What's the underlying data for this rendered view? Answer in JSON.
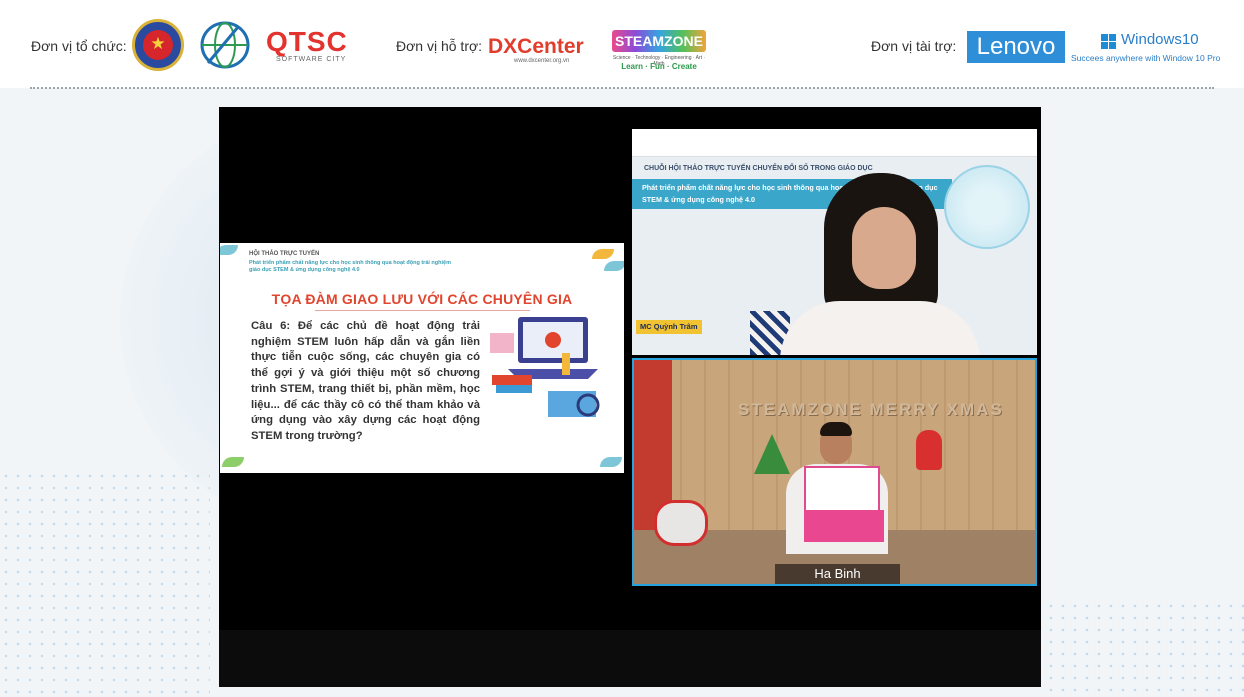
{
  "header": {
    "organizer_label": "Đơn vị tổ chức:",
    "support_label": "Đơn vị hỗ trợ:",
    "sponsor_label": "Đơn vị tài trợ:",
    "qtsc_logo": "QTSC",
    "qtsc_sub": "SOFTWARE CITY",
    "dxcenter_logo": "DXCenter",
    "dxcenter_url": "www.dxcenter.org.vn",
    "steamzone_logo": "STEAMZONE",
    "steamzone_mini": "Science · Technology · Engineering · Art · Math",
    "steamzone_tagline": "Learn · Fun · Create",
    "lenovo_logo": "Lenovo",
    "windows_logo": "Windows10",
    "windows_tagline": "Succees anywhere with Window 10 Pro"
  },
  "slide": {
    "top_label": "HỘI THẢO TRỰC TUYẾN",
    "subtitle": "Phát triển phẩm chất năng lực cho học sinh thông qua hoạt động trải nghiệm giáo dục STEM & ứng dụng công nghệ 4.0",
    "title": "TỌA ĐÀM GIAO LƯU VỚI CÁC CHUYÊN GIA",
    "question": "Câu 6: Để các chủ đề hoạt động trải nghiệm STEM luôn hấp dẫn và gắn liền thực tiễn cuộc sống, các chuyên gia có thể gợi ý và giới thiệu một số chương trình STEM, trang thiết bị, phần mềm, học liệu... để các thầy cô có thể tham khảo và ứng dụng vào xây dựng các hoạt động STEM trong trường?"
  },
  "mc_tile": {
    "series_title": "CHUỖI HỘI THẢO TRỰC TUYẾN CHUYỂN ĐỔI SỐ TRONG GIÁO DỤC",
    "banner": "Phát triển phẩm chất năng lực cho học sinh thông qua hoạt động trải nghiệm giáo dục STEM & ứng dụng công nghệ 4.0",
    "name_tag": "MC Quỳnh Trâm"
  },
  "speaker_tile": {
    "wall_sign": "STEAMZONE MERRY XMAS",
    "name": "Ha Binh"
  }
}
